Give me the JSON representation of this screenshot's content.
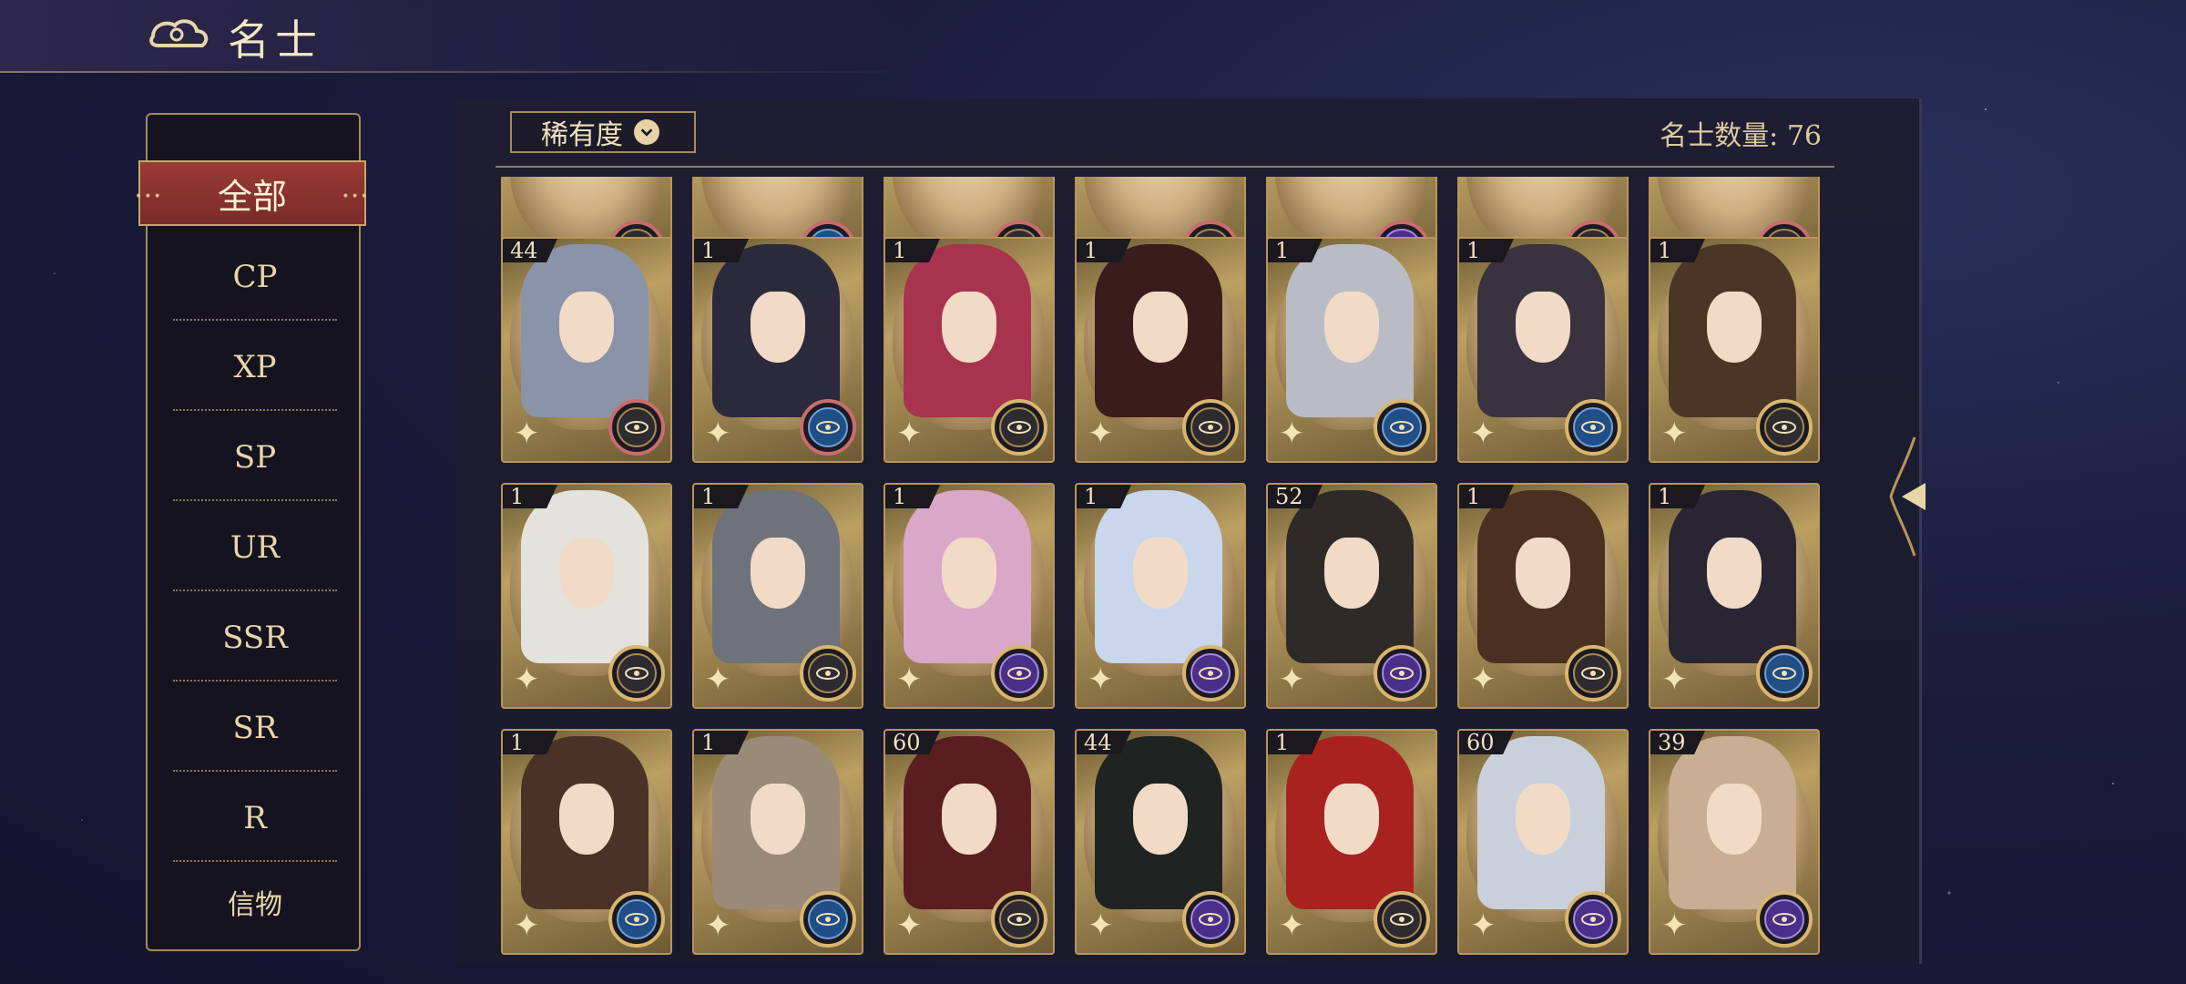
{
  "header": {
    "title": "名士"
  },
  "sidebar": {
    "items": [
      {
        "label": "全部",
        "active": true
      },
      {
        "label": "CP"
      },
      {
        "label": "XP"
      },
      {
        "label": "SP"
      },
      {
        "label": "UR"
      },
      {
        "label": "SSR"
      },
      {
        "label": "SR"
      },
      {
        "label": "R"
      },
      {
        "label": "信物"
      }
    ]
  },
  "filter": {
    "label": "稀有度"
  },
  "count": {
    "text": "名士数量: 76"
  },
  "cards_partial": [
    {
      "badge": "gold"
    },
    {
      "badge": "blue"
    },
    {
      "badge": "gold"
    },
    {
      "badge": "gold"
    },
    {
      "badge": "purple"
    },
    {
      "badge": "gold"
    },
    {
      "badge": "gold"
    }
  ],
  "cards": [
    {
      "level": "44",
      "badge": "gold",
      "hair": "#8a93a8",
      "ring": "red"
    },
    {
      "level": "1",
      "badge": "blue",
      "hair": "#2b2a3c",
      "ring": "red"
    },
    {
      "level": "1",
      "badge": "gold",
      "hair": "#a8334e",
      "ring": "gold"
    },
    {
      "level": "1",
      "badge": "gold",
      "hair": "#3a1c1c",
      "ring": "gold"
    },
    {
      "level": "1",
      "badge": "blue",
      "hair": "#b9bcc4",
      "ring": "gold"
    },
    {
      "level": "1",
      "badge": "blue",
      "hair": "#38333f",
      "ring": "gold"
    },
    {
      "level": "1",
      "badge": "gold",
      "hair": "#4a3526",
      "ring": "gold"
    },
    {
      "level": "1",
      "badge": "gold",
      "hair": "#e4e2dc",
      "ring": "gold"
    },
    {
      "level": "1",
      "badge": "gold",
      "hair": "#6e727a",
      "ring": "gold"
    },
    {
      "level": "1",
      "badge": "purple",
      "hair": "#d9a8c8",
      "ring": "gold"
    },
    {
      "level": "1",
      "badge": "purple",
      "hair": "#c9d6ec",
      "ring": "gold"
    },
    {
      "level": "52",
      "badge": "purple",
      "hair": "#2e2a28",
      "ring": "gold"
    },
    {
      "level": "1",
      "badge": "gold",
      "hair": "#4b3022",
      "ring": "gold"
    },
    {
      "level": "1",
      "badge": "blue",
      "hair": "#2a2532",
      "ring": "gold"
    },
    {
      "level": "1",
      "badge": "blue",
      "hair": "#4a3326",
      "ring": "gold"
    },
    {
      "level": "1",
      "badge": "blue",
      "hair": "#9a8a78",
      "ring": "gold"
    },
    {
      "level": "60",
      "badge": "gold",
      "hair": "#5a1e20",
      "ring": "gold"
    },
    {
      "level": "44",
      "badge": "purple",
      "hair": "#1f2422",
      "ring": "gold"
    },
    {
      "level": "1",
      "badge": "gold",
      "hair": "#a8221f",
      "ring": "gold"
    },
    {
      "level": "60",
      "badge": "purple",
      "hair": "#c9d0dc",
      "ring": "gold"
    },
    {
      "level": "39",
      "badge": "purple",
      "hair": "#c9ae94",
      "ring": "gold"
    }
  ],
  "colors": {
    "accent": "#9a3a35",
    "frame": "#b8955a",
    "background": "#1c1d3d"
  }
}
